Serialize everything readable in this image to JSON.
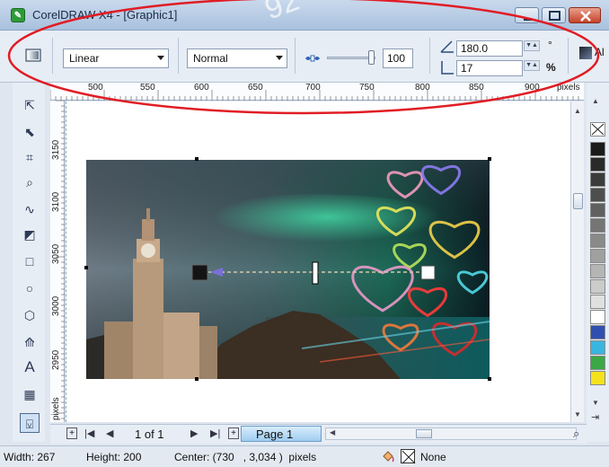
{
  "window": {
    "title": "CorelDRAW X4 - [Graphic1]"
  },
  "property_bar": {
    "fill_type": "Linear",
    "blend_mode": "Normal",
    "midpoint_value": "100",
    "angle_value": "180.0",
    "angle_unit": "°",
    "edge_pad_value": "17",
    "edge_pad_unit": "%",
    "apply_label": "Al"
  },
  "ruler": {
    "units": "pixels",
    "top_ticks": [
      "500",
      "550",
      "600",
      "650",
      "700",
      "750",
      "800",
      "850",
      "900"
    ],
    "left_ticks": [
      "3150",
      "3100",
      "3050",
      "3000",
      "2950"
    ],
    "left_units": "pixels"
  },
  "page_nav": {
    "page_count_text": "1 of 1",
    "page_tab": "Page 1"
  },
  "status": {
    "width_text": "Width: 267",
    "height_text": "Height: 200",
    "center_text": "Center: (730   , 3,034 )  pixels",
    "fill_none_label": "None"
  },
  "palette": {
    "colors": [
      "#1a1a1a",
      "#2a2a2a",
      "#3c3c3c",
      "#4e4e4e",
      "#606060",
      "#757575",
      "#8a8a8a",
      "#a0a0a0",
      "#b5b5b5",
      "#cbcbcb",
      "#e0e0e0",
      "#ffffff",
      "#2f4fb0",
      "#39b6e0",
      "#3aa845",
      "#f5e21c"
    ]
  },
  "annotation": {
    "watermark": "92"
  },
  "colors": {
    "accent": "#e11c24"
  }
}
